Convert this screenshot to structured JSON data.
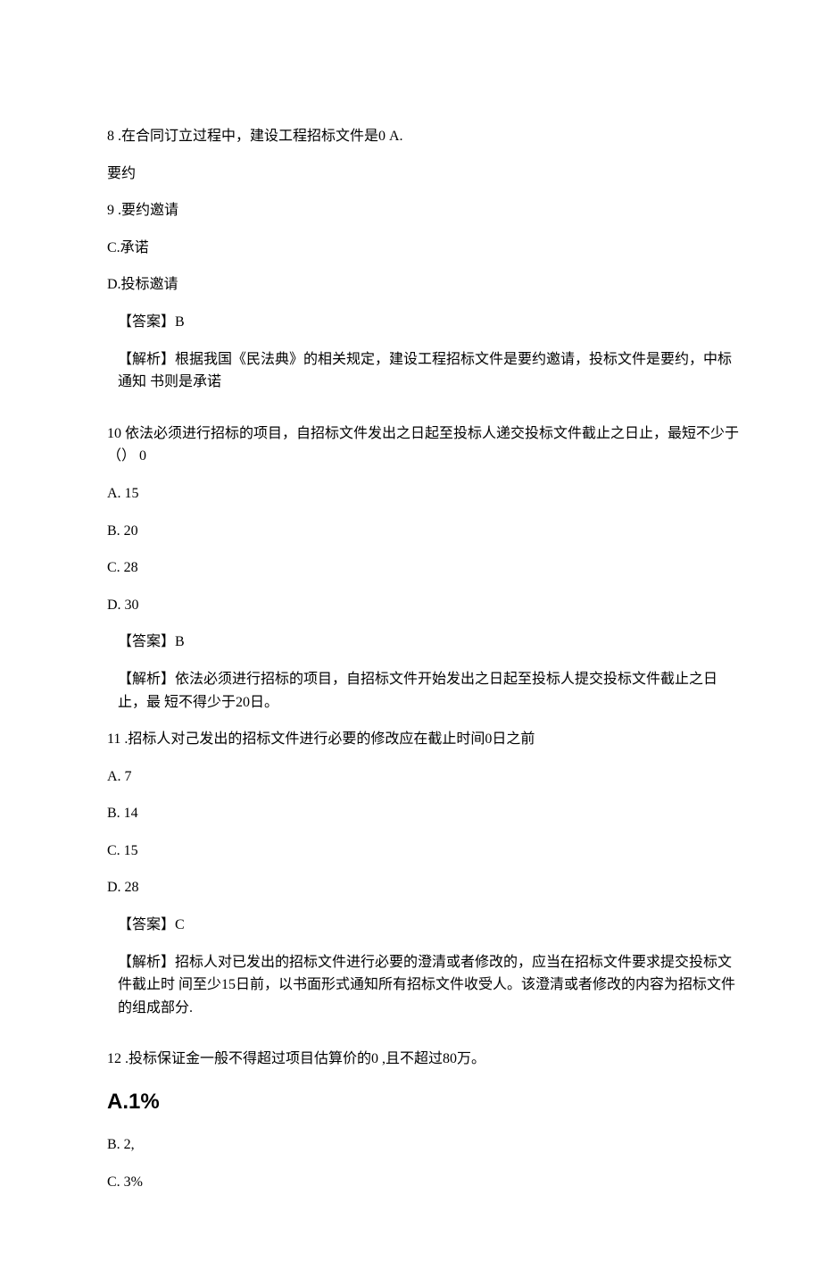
{
  "q8": {
    "stem": "8 .在合同订立过程中，建设工程招标文件是0 A.",
    "optA2": "要约",
    "optB": "9 .要约邀请",
    "optC": "C.承诺",
    "optD": "D.投标邀请",
    "ans": "【答案】B",
    "expl": "【解析】根据我国《民法典》的相关规定，建设工程招标文件是要约邀请，投标文件是要约，中标通知 书则是承诺"
  },
  "q10": {
    "stem": "10 依法必须进行招标的项目，自招标文件发出之日起至投标人递交投标文件截止之日止，最短不少于（） 0",
    "optA": "A.  15",
    "optB": "B.  20",
    "optC": "C.  28",
    "optD": "D.  30",
    "ans": "【答案】B",
    "expl": "【解析】依法必须进行招标的项目，自招标文件开始发出之日起至投标人提交投标文件截止之日止，最 短不得少于20日。"
  },
  "q11": {
    "stem": "11 .招标人对己发出的招标文件进行必要的修改应在截止时间0日之前",
    "optA": "A.  7",
    "optB": "B.  14",
    "optC": "C.  15",
    "optD": "D.  28",
    "ans": "【答案】C",
    "expl": "【解析】招标人对已发出的招标文件进行必要的澄清或者修改的，应当在招标文件要求提交投标文件截止时 间至少15日前，以书面形式通知所有招标文件收受人。该澄清或者修改的内容为招标文件的组成部分."
  },
  "q12": {
    "stem": "12 .投标保证金一般不得超过项目估算价的0 ,且不超过80万。",
    "optA": "A.1%",
    "optB": "B.  2,",
    "optC": "C.  3%"
  }
}
